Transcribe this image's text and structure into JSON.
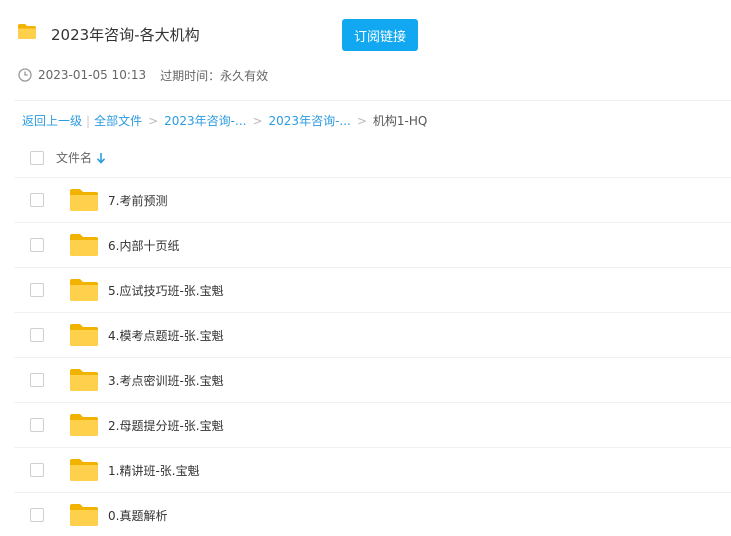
{
  "header": {
    "title": "2023年咨询-各大机构",
    "subscribe_label": "订阅链接",
    "date": "2023-01-05 10:13",
    "expire_label": "过期时间：永久有效"
  },
  "breadcrumb": {
    "back": "返回上一级",
    "all": "全部文件",
    "crumb1": "2023年咨询-...",
    "crumb2": "2023年咨询-...",
    "current": "机构1-HQ"
  },
  "list": {
    "column_label": "文件名",
    "items": [
      {
        "name": "7.考前预测"
      },
      {
        "name": "6.内部十页纸"
      },
      {
        "name": "5.应试技巧班-张.宝魁"
      },
      {
        "name": "4.模考点题班-张.宝魁"
      },
      {
        "name": "3.考点密训班-张.宝魁"
      },
      {
        "name": "2.母题提分班-张.宝魁"
      },
      {
        "name": "1.精讲班-张.宝魁"
      },
      {
        "name": "0.真题解析"
      }
    ]
  },
  "colors": {
    "accent": "#12a8f1",
    "link": "#2c9be0",
    "folder": "#ffd04b"
  },
  "icons": [
    "folder-icon",
    "clock-icon",
    "sort-down-icon",
    "checkbox"
  ]
}
